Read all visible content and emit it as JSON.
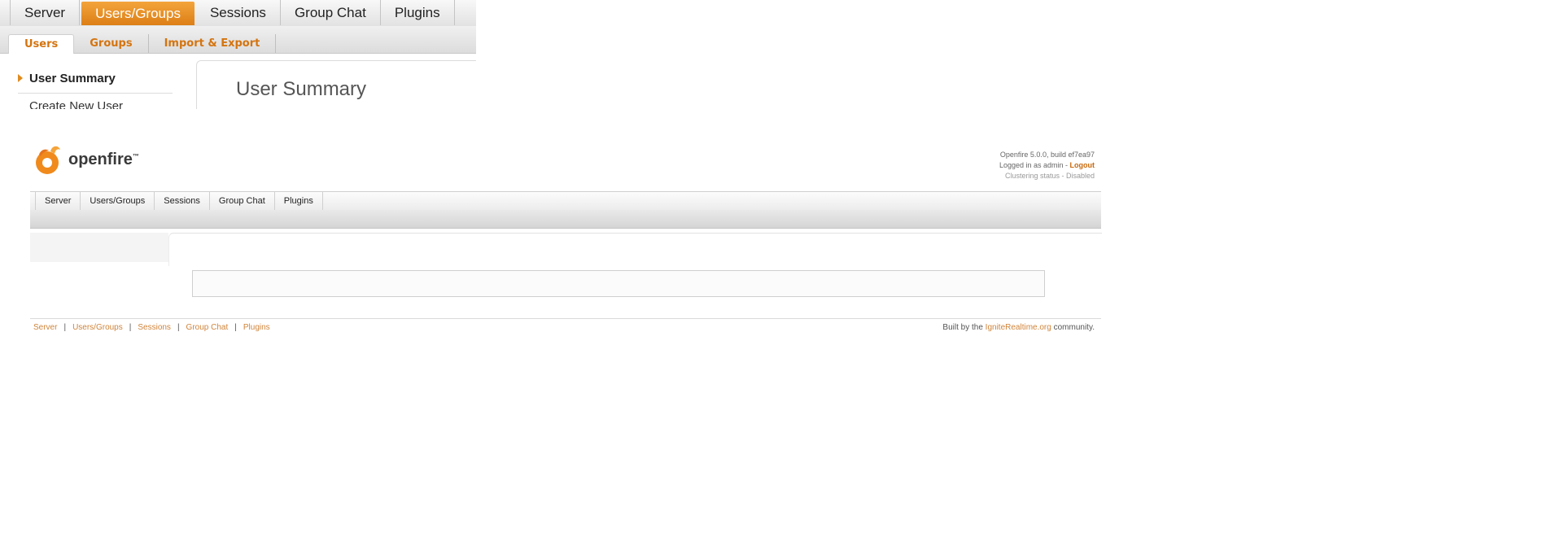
{
  "zoom": {
    "tabs": [
      {
        "label": "Server"
      },
      {
        "label": "Users/Groups"
      },
      {
        "label": "Sessions"
      },
      {
        "label": "Group Chat"
      },
      {
        "label": "Plugins"
      }
    ],
    "active_tab": "Users/Groups",
    "subtabs": [
      {
        "label": "Users"
      },
      {
        "label": "Groups"
      },
      {
        "label": "Import & Export"
      }
    ],
    "active_subtab": "Users",
    "sidebar": {
      "active_item": "User Summary",
      "next_item": "Create New User"
    },
    "content_title": "User Summary"
  },
  "header": {
    "brand": "openfire",
    "trademark": "™",
    "version": "Openfire 5.0.0, build ef7ea97",
    "logged_in_prefix": "Logged in as admin - ",
    "logout": "Logout",
    "clustering": "Clustering status - Disabled"
  },
  "nav": {
    "items": [
      {
        "label": "Server"
      },
      {
        "label": "Users/Groups"
      },
      {
        "label": "Sessions"
      },
      {
        "label": "Group Chat"
      },
      {
        "label": "Plugins"
      }
    ]
  },
  "footer": {
    "links": [
      {
        "label": "Server"
      },
      {
        "label": "Users/Groups"
      },
      {
        "label": "Sessions"
      },
      {
        "label": "Group Chat"
      },
      {
        "label": "Plugins"
      }
    ],
    "separator": "|",
    "credit_prefix": "Built by the ",
    "credit_link": "IgniteRealtime.org",
    "credit_suffix": " community."
  },
  "colors": {
    "accent": "#e08a1e",
    "link": "#d0843a"
  }
}
